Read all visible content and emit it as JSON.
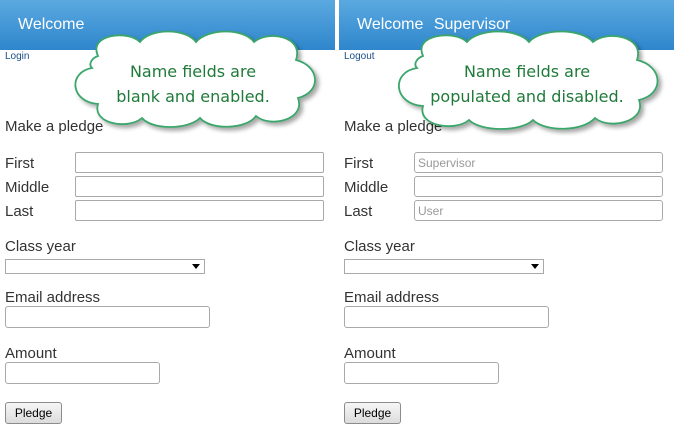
{
  "left_panel": {
    "header_title": "Welcome",
    "header_user": "",
    "nav_link": "Login",
    "section_title": "Make a pledge",
    "name_fields": [
      {
        "label": "First",
        "value": ""
      },
      {
        "label": "Middle",
        "value": ""
      },
      {
        "label": "Last",
        "value": ""
      }
    ],
    "class_year_label": "Class year",
    "email_label": "Email address",
    "amount_label": "Amount",
    "pledge_button": "Pledge",
    "callout_line1": "Name fields are",
    "callout_line2": "blank and enabled."
  },
  "right_panel": {
    "header_title": "Welcome",
    "header_user": "Supervisor",
    "nav_link": "Logout",
    "section_title": "Make a pledge",
    "name_fields": [
      {
        "label": "First",
        "value": "Supervisor"
      },
      {
        "label": "Middle",
        "value": ""
      },
      {
        "label": "Last",
        "value": "User"
      }
    ],
    "class_year_label": "Class year",
    "email_label": "Email address",
    "amount_label": "Amount",
    "pledge_button": "Pledge",
    "callout_line1": "Name fields are",
    "callout_line2": "populated and disabled."
  },
  "colors": {
    "header_gradient_top": "#5aa9e0",
    "header_gradient_bottom": "#2f86cc",
    "callout_text": "#1f7a3a",
    "callout_border": "#3aa56a"
  }
}
